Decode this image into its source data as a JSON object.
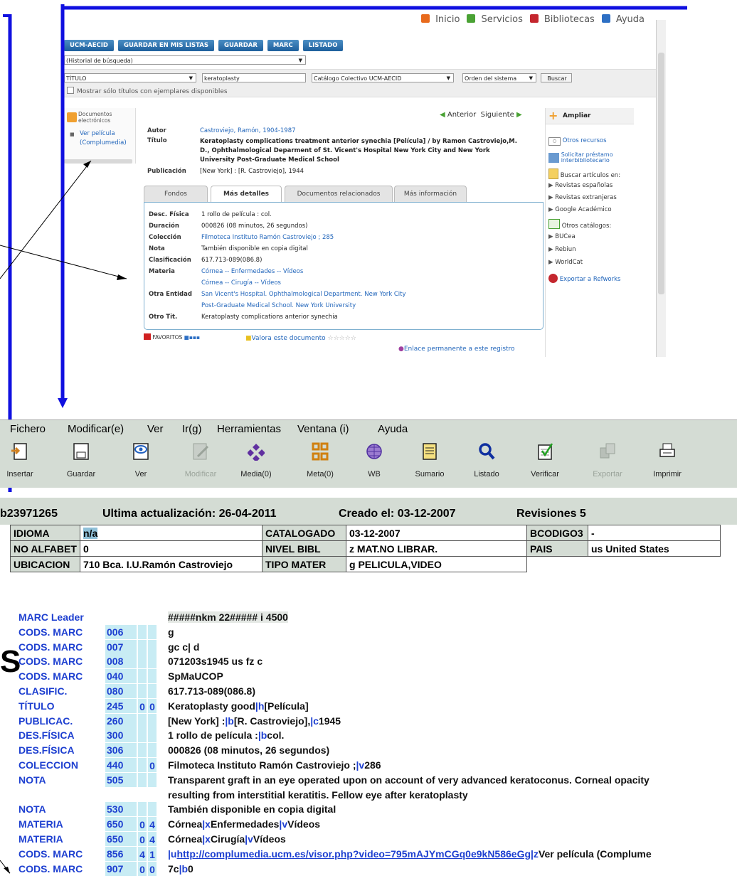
{
  "opac": {
    "topnav": [
      {
        "label": "Inicio",
        "color": "#e86a1c"
      },
      {
        "label": "Servicios",
        "color": "#4aa234"
      },
      {
        "label": "Bibliotecas",
        "color": "#c4262e"
      },
      {
        "label": "Ayuda",
        "color": "#2d6fc4"
      }
    ],
    "toolbar_buttons": [
      "UCM-AECID",
      "GUARDAR EN MIS LISTAS",
      "GUARDAR",
      "MARC",
      "LISTADO"
    ],
    "history_select": "(Historial de búsqueda)",
    "search": {
      "field": "TÍTULO",
      "query": "keratoplasty",
      "catalog": "Catálogo Colectivo UCM-AECID",
      "order": "Orden del sistema",
      "button": "Buscar",
      "checkbox_label": "Mostrar sólo títulos con ejemplares disponibles"
    },
    "left_panel": {
      "header": "Documentos electrónicos",
      "link": "Ver película (Complumedia)"
    },
    "nav": {
      "prev": "Anterior",
      "next": "Siguiente"
    },
    "record": {
      "autor_label": "Autor",
      "autor": "Castroviejo, Ramón, 1904-1987",
      "titulo_label": "Título",
      "titulo_lines": [
        "Keratoplasty complications treatment anterior synechia [Película] / by Ramon Castroviejo,M.",
        "D., Ophthalmological Deparment of St. Vicent's Hospital New York City and New York",
        "University Post-Graduate Medical School"
      ],
      "publicacion_label": "Publicación",
      "publicacion": "[New York] : [R. Castroviejo], 1944"
    },
    "tabs": [
      "Fondos",
      "Más detalles",
      "Documentos relacionados",
      "Más información"
    ],
    "details": [
      {
        "label": "Desc. Física",
        "value": "1 rollo de película : col.",
        "link": false
      },
      {
        "label": "Duración",
        "value": "000826 (08 minutos, 26 segundos)",
        "link": false
      },
      {
        "label": "Colección",
        "value": "Filmoteca Instituto Ramón Castroviejo ; 285",
        "link": true
      },
      {
        "label": "Nota",
        "value": "También disponible en copia digital",
        "link": false
      },
      {
        "label": "Clasificación",
        "value": "617.713-089(086.8)",
        "link": false
      },
      {
        "label": "Materia",
        "value": "Córnea -- Enfermedades -- Vídeos",
        "link": true
      },
      {
        "label": "",
        "value": "Córnea -- Cirugía -- Vídeos",
        "link": true
      },
      {
        "label": "Otra Entidad",
        "value": "San Vicent's Hospital. Ophthalmological Department. New York City",
        "link": true
      },
      {
        "label": "",
        "value": "Post-Graduate Medical School. New York University",
        "link": true
      },
      {
        "label": "Otro Tit.",
        "value": "Keratoplasty complications anterior synechia",
        "link": false
      }
    ],
    "bottom": {
      "favoritos": "FAVORITOS",
      "valora": "Valora este documento",
      "enlace": "Enlace permanente a este registro"
    },
    "right_panel": {
      "ampliar": "Ampliar",
      "otros_recursos": "Otros recursos",
      "solicitar_line1": "Solicitar préstamo",
      "solicitar_line2": "interbibliotecario",
      "buscar_articulos": "Buscar artículos en:",
      "articulos": [
        "Revistas españolas",
        "Revistas extranjeras",
        "Google Académico"
      ],
      "otros_catalogos": "Otros catálogos:",
      "catalogos": [
        "BUCea",
        "Rebiun",
        "WorldCat"
      ],
      "exportar": "Exportar a Refworks"
    }
  },
  "client": {
    "menu": [
      "Fichero",
      "Modificar(e)",
      "Ver",
      "Ir(g)",
      "Herramientas",
      "Ventana (i)",
      "Ayuda"
    ],
    "tools": [
      {
        "label": "Insertar",
        "icon": "insert-icon",
        "enabled": true
      },
      {
        "label": "Guardar",
        "icon": "save-icon",
        "enabled": true
      },
      {
        "label": "Ver",
        "icon": "eye-icon",
        "enabled": true
      },
      {
        "label": "Modificar",
        "icon": "edit-icon",
        "enabled": false
      },
      {
        "label": "Media(0)",
        "icon": "media-icon",
        "enabled": true
      },
      {
        "label": "Meta(0)",
        "icon": "meta-icon",
        "enabled": true
      },
      {
        "label": "WB",
        "icon": "globe-icon",
        "enabled": true
      },
      {
        "label": "Sumario",
        "icon": "summary-icon",
        "enabled": true
      },
      {
        "label": "Listado",
        "icon": "magnifier-icon",
        "enabled": true
      },
      {
        "label": "Verificar",
        "icon": "checklist-icon",
        "enabled": true
      },
      {
        "label": "Exportar",
        "icon": "export-icon",
        "enabled": false
      },
      {
        "label": "Imprimir",
        "icon": "printer-icon",
        "enabled": true
      }
    ],
    "record_id": "b23971265",
    "ultima": "Ultima actualización: 26-04-2011",
    "creado": "Creado el: 03-12-2007",
    "revisiones": "Revisiones 5",
    "fixed_fields": [
      [
        "IDIOMA",
        "n/a",
        "CATALOGADO",
        "03-12-2007",
        "BCODIGO3",
        "-"
      ],
      [
        "NO ALFABET",
        "0",
        "NIVEL BIBL",
        "z  MAT.NO LIBRAR.",
        "PAIS",
        "us   United States"
      ],
      [
        "UBICACION",
        "710    Bca. I.U.Ramón Castroviejo",
        "TIPO MATER",
        "g  PELICULA,VIDEO",
        "",
        ""
      ]
    ],
    "marc": [
      {
        "label": "MARC Leader",
        "tag": "",
        "i1": "",
        "i2": "",
        "parts": [
          [
            "t",
            "#####nkm  22#####  i  4500"
          ]
        ]
      },
      {
        "label": "CODS. MARC",
        "tag": "006",
        "i1": "",
        "i2": "",
        "parts": [
          [
            "t",
            "g"
          ]
        ]
      },
      {
        "label": "CODS. MARC",
        "tag": "007",
        "i1": "",
        "i2": "",
        "parts": [
          [
            "t",
            "gc c|  d"
          ]
        ]
      },
      {
        "label": "CODS. MARC",
        "tag": "008",
        "i1": "",
        "i2": "",
        "parts": [
          [
            "t",
            "071203s1945    us            fz    c"
          ]
        ]
      },
      {
        "label": "CODS. MARC",
        "tag": "040",
        "i1": "",
        "i2": "",
        "parts": [
          [
            "t",
            "SpMaUCOP"
          ]
        ]
      },
      {
        "label": "CLASIFIC.",
        "tag": "080",
        "i1": "",
        "i2": "",
        "parts": [
          [
            "t",
            "617.713-089(086.8)"
          ]
        ]
      },
      {
        "label": "TÍTULO",
        "tag": "245",
        "i1": "0",
        "i2": "0",
        "parts": [
          [
            "t",
            "Keratoplasty good"
          ],
          [
            "s",
            "|h"
          ],
          [
            "t",
            "[Película]"
          ]
        ]
      },
      {
        "label": "PUBLICAC.",
        "tag": "260",
        "i1": "",
        "i2": "",
        "parts": [
          [
            "t",
            "[New York] :"
          ],
          [
            "s",
            "|b"
          ],
          [
            "t",
            "[R. Castroviejo],"
          ],
          [
            "s",
            "|c"
          ],
          [
            "t",
            "1945"
          ]
        ]
      },
      {
        "label": "DES.FÍSICA",
        "tag": "300",
        "i1": "",
        "i2": "",
        "parts": [
          [
            "t",
            "1 rollo de película :"
          ],
          [
            "s",
            "|b"
          ],
          [
            "t",
            "col."
          ]
        ]
      },
      {
        "label": "DES.FÍSICA",
        "tag": "306",
        "i1": "",
        "i2": "",
        "parts": [
          [
            "t",
            "000826 (08 minutos, 26 segundos)"
          ]
        ]
      },
      {
        "label": "COLECCION",
        "tag": "440",
        "i1": "",
        "i2": "0",
        "parts": [
          [
            "t",
            "Filmoteca Instituto Ramón Castroviejo ;"
          ],
          [
            "s",
            "|v"
          ],
          [
            "t",
            "286"
          ]
        ]
      },
      {
        "label": "NOTA",
        "tag": "505",
        "i1": "",
        "i2": "",
        "parts": [
          [
            "t",
            "Transparent graft in an eye operated upon on account of very advanced keratoconus. Corneal opacity"
          ]
        ]
      },
      {
        "label": "",
        "tag": "",
        "i1": "",
        "i2": "",
        "parts": [
          [
            "t",
            "resulting from interstitial keratitis. Fellow eye after keratoplasty"
          ]
        ]
      },
      {
        "label": "NOTA",
        "tag": "530",
        "i1": "",
        "i2": "",
        "parts": [
          [
            "t",
            "También disponible en copia digital"
          ]
        ]
      },
      {
        "label": "MATERIA",
        "tag": "650",
        "i1": "0",
        "i2": "4",
        "parts": [
          [
            "t",
            "Córnea"
          ],
          [
            "s",
            "|x"
          ],
          [
            "t",
            "Enfermedades"
          ],
          [
            "s",
            "|v"
          ],
          [
            "t",
            "Vídeos"
          ]
        ]
      },
      {
        "label": "MATERIA",
        "tag": "650",
        "i1": "0",
        "i2": "4",
        "parts": [
          [
            "t",
            "Córnea"
          ],
          [
            "s",
            "|x"
          ],
          [
            "t",
            "Cirugía"
          ],
          [
            "s",
            "|v"
          ],
          [
            "t",
            "Vídeos"
          ]
        ]
      },
      {
        "label": "CODS. MARC",
        "tag": "856",
        "i1": "4",
        "i2": "1",
        "parts": [
          [
            "s",
            "|u"
          ],
          [
            "u",
            "http://complumedia.ucm.es/visor.php?video=795mAJYmCGq0e9kN586eGg"
          ],
          [
            "s",
            "|z"
          ],
          [
            "t",
            "Ver película (Complume"
          ]
        ]
      },
      {
        "label": "CODS. MARC",
        "tag": "907",
        "i1": "0",
        "i2": "0",
        "parts": [
          [
            "t",
            "7c"
          ],
          [
            "s",
            "|b"
          ],
          [
            "t",
            "0"
          ]
        ]
      }
    ],
    "big_letter": "S"
  }
}
